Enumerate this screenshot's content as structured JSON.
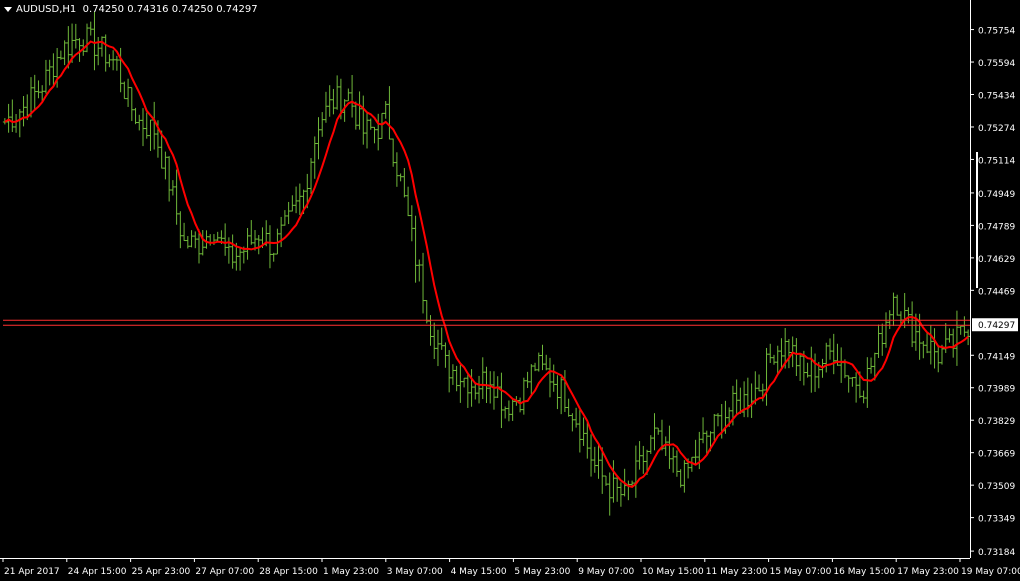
{
  "header": {
    "symbol": "AUDUSD,H1",
    "ohlc": "0.74250 0.74316 0.74250 0.74297"
  },
  "colors": {
    "background": "#000000",
    "bar": "#6fb83a",
    "ma": "#ff0000",
    "axis": "#ffffff",
    "price_line": "#ff3030"
  },
  "chart_data": {
    "type": "ohlc",
    "title": "AUDUSD,H1",
    "y_ticks": [
      "0.75754",
      "0.75594",
      "0.75434",
      "0.75274",
      "0.75114",
      "0.74949",
      "0.74789",
      "0.74629",
      "0.74469",
      "0.74297",
      "0.74149",
      "0.73989",
      "0.73829",
      "0.73669",
      "0.73509",
      "0.73349",
      "0.73184"
    ],
    "x_ticks": [
      "21 Apr 2017",
      "24 Apr 15:00",
      "25 Apr 23:00",
      "27 Apr 07:00",
      "28 Apr 15:00",
      "1 May 23:00",
      "3 May 07:00",
      "4 May 15:00",
      "5 May 23:00",
      "9 May 07:00",
      "10 May 15:00",
      "11 May 23:00",
      "15 May 07:00",
      "16 May 15:00",
      "17 May 23:00",
      "19 May 07:00"
    ],
    "current_price": 0.74297,
    "current_price_label": "0.74297",
    "ylim": [
      0.7315,
      0.7588
    ],
    "anchors": [
      [
        0,
        0.753
      ],
      [
        5,
        0.7537
      ],
      [
        10,
        0.7548
      ],
      [
        15,
        0.7565
      ],
      [
        20,
        0.7572
      ],
      [
        25,
        0.7567
      ],
      [
        30,
        0.7558
      ],
      [
        33,
        0.754
      ],
      [
        36,
        0.753
      ],
      [
        40,
        0.7526
      ],
      [
        44,
        0.75
      ],
      [
        48,
        0.747
      ],
      [
        52,
        0.747
      ],
      [
        56,
        0.7478
      ],
      [
        60,
        0.7462
      ],
      [
        64,
        0.7467
      ],
      [
        68,
        0.7475
      ],
      [
        72,
        0.7468
      ],
      [
        76,
        0.748
      ],
      [
        80,
        0.7495
      ],
      [
        84,
        0.753
      ],
      [
        88,
        0.754
      ],
      [
        92,
        0.7543
      ],
      [
        96,
        0.7525
      ],
      [
        100,
        0.7527
      ],
      [
        102,
        0.7533
      ],
      [
        106,
        0.75
      ],
      [
        110,
        0.7463
      ],
      [
        114,
        0.743
      ],
      [
        118,
        0.741
      ],
      [
        122,
        0.7405
      ],
      [
        126,
        0.74
      ],
      [
        130,
        0.7405
      ],
      [
        134,
        0.739
      ],
      [
        138,
        0.7395
      ],
      [
        142,
        0.741
      ],
      [
        146,
        0.7405
      ],
      [
        150,
        0.7395
      ],
      [
        154,
        0.738
      ],
      [
        158,
        0.736
      ],
      [
        162,
        0.735
      ],
      [
        166,
        0.7345
      ],
      [
        170,
        0.736
      ],
      [
        174,
        0.7375
      ],
      [
        178,
        0.7362
      ],
      [
        182,
        0.7355
      ],
      [
        186,
        0.737
      ],
      [
        190,
        0.738
      ],
      [
        194,
        0.7388
      ],
      [
        198,
        0.7393
      ],
      [
        202,
        0.74
      ],
      [
        206,
        0.7418
      ],
      [
        210,
        0.742
      ],
      [
        214,
        0.7405
      ],
      [
        218,
        0.741
      ],
      [
        222,
        0.7418
      ],
      [
        226,
        0.7405
      ],
      [
        230,
        0.74
      ],
      [
        234,
        0.742
      ],
      [
        238,
        0.7445
      ],
      [
        242,
        0.743
      ],
      [
        246,
        0.7422
      ],
      [
        250,
        0.7415
      ],
      [
        254,
        0.742
      ],
      [
        258,
        0.743
      ]
    ],
    "ma_period": 8
  }
}
